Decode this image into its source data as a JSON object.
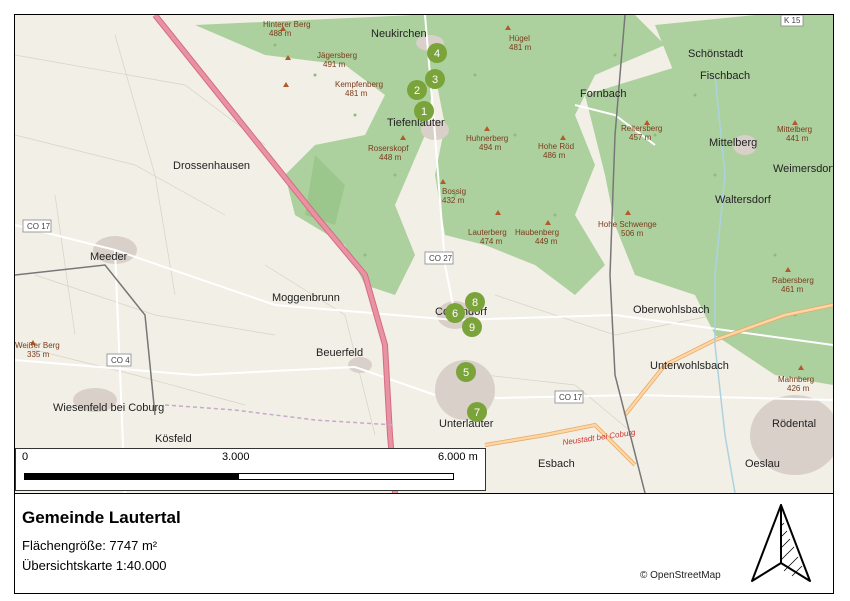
{
  "title": "Gemeinde Lautertal",
  "area_text": "Flächengröße: 7747 m²",
  "overview_text": "Übersichtskarte 1:40.000",
  "attribution": "© OpenStreetMap",
  "scale": {
    "labels": [
      "0",
      "3.000",
      "6.000 m"
    ]
  },
  "map": {
    "places": [
      {
        "name": "Neukirchen"
      },
      {
        "name": "Schönstadt"
      },
      {
        "name": "Fischbach"
      },
      {
        "name": "Fornbach"
      },
      {
        "name": "Tiefenlauter"
      },
      {
        "name": "Drossenhausen"
      },
      {
        "name": "Mittelberg"
      },
      {
        "name": "Weimersdorf"
      },
      {
        "name": "Waltersdorf"
      },
      {
        "name": "Meeder"
      },
      {
        "name": "Moggenbrunn"
      },
      {
        "name": "Oberwohlsbach"
      },
      {
        "name": "Beuerfeld"
      },
      {
        "name": "Unterwohlsbach"
      },
      {
        "name": "Wiesenfeld bei Coburg"
      },
      {
        "name": "Kösfeld"
      },
      {
        "name": "Unterlauter"
      },
      {
        "name": "Esbach"
      },
      {
        "name": "Rödental"
      },
      {
        "name": "Oeslau"
      },
      {
        "name": "Cortendorf"
      }
    ],
    "peaks": [
      {
        "name": "Hinterer Berg",
        "elev": "488 m"
      },
      {
        "name": "Jägersberg",
        "elev": "491 m"
      },
      {
        "name": "Kempfenberg",
        "elev": "481 m"
      },
      {
        "name": "Roserskopf",
        "elev": "448 m"
      },
      {
        "name": "Hügel",
        "elev": "481 m"
      },
      {
        "name": "Huhnerberg",
        "elev": "494 m"
      },
      {
        "name": "Hohe Röd",
        "elev": "486 m"
      },
      {
        "name": "Bossig",
        "elev": "432 m"
      },
      {
        "name": "Lauterberg",
        "elev": "474 m"
      },
      {
        "name": "Haubenberg",
        "elev": "449 m"
      },
      {
        "name": "Reitersberg",
        "elev": "457 m"
      },
      {
        "name": "Mittelberg",
        "elev": "441 m"
      },
      {
        "name": "Hohe Schwenge",
        "elev": "506 m"
      },
      {
        "name": "Rabersberg",
        "elev": "461 m"
      },
      {
        "name": "Weißer Berg",
        "elev": "335 m"
      },
      {
        "name": "Mahnberg",
        "elev": "426 m"
      }
    ],
    "roads": [
      "CO 17",
      "CO 27",
      "CO 4",
      "CO 17",
      "K 15",
      "Neustadt bei Coburg"
    ],
    "markers": [
      "1",
      "2",
      "3",
      "4",
      "5",
      "6",
      "7",
      "8",
      "9"
    ],
    "colors": {
      "forest": "#add19e",
      "forest_dark": "#8dbb7e",
      "marker": "#7aa33a",
      "motorway": "#e892a2",
      "primary": "#fcd6a4",
      "residential": "#d9d0c9"
    }
  }
}
